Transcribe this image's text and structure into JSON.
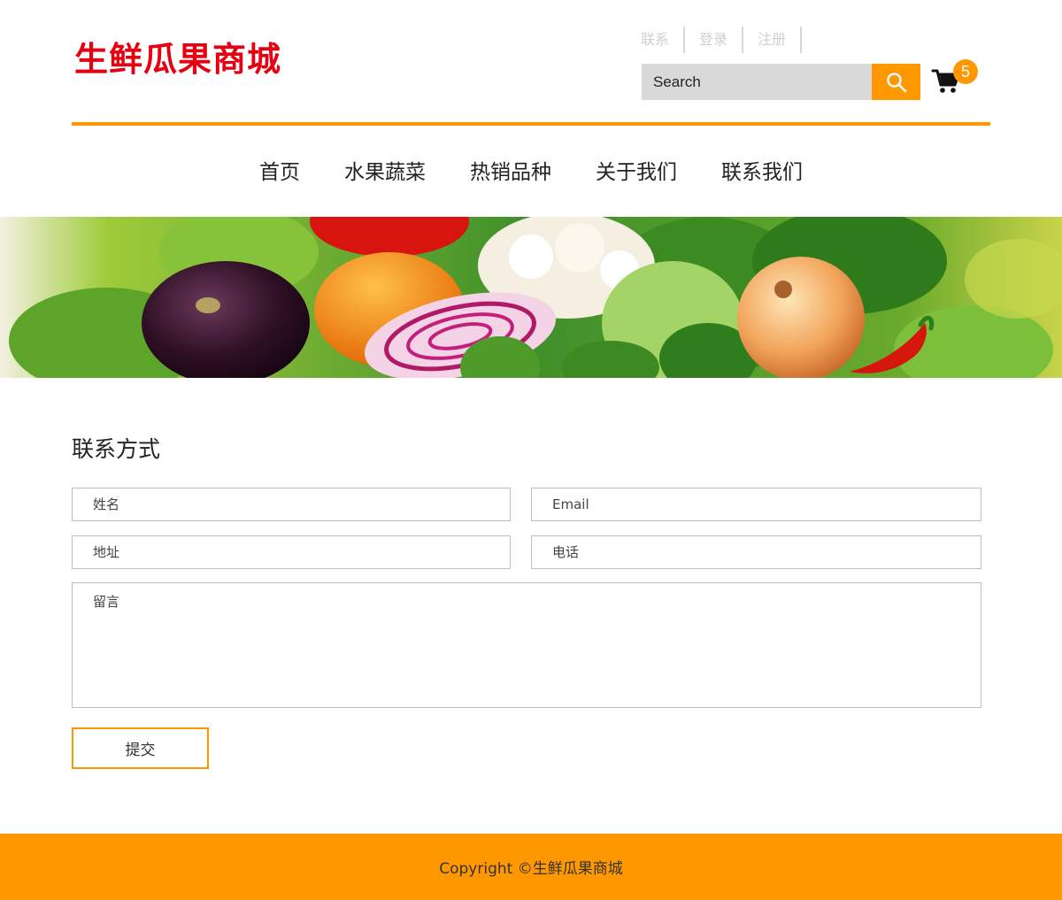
{
  "header": {
    "logo_text": "生鲜瓜果商城",
    "top_links": [
      "联系",
      "登录",
      "注册"
    ],
    "search_placeholder": "Search",
    "cart_count": "5"
  },
  "nav": {
    "items": [
      "首页",
      "水果蔬菜",
      "热销品种",
      "关于我们",
      "联系我们"
    ]
  },
  "contact": {
    "title": "联系方式",
    "name_placeholder": "姓名",
    "email_placeholder": "Email",
    "address_placeholder": "地址",
    "phone_placeholder": "电话",
    "message_placeholder": "留言",
    "submit_label": "提交"
  },
  "footer": {
    "copyright": "Copyright ©生鲜瓜果商城"
  },
  "colors": {
    "accent": "#ff9800",
    "logo": "#e60012"
  },
  "icons": {
    "search": "search-icon",
    "cart": "cart-icon"
  }
}
